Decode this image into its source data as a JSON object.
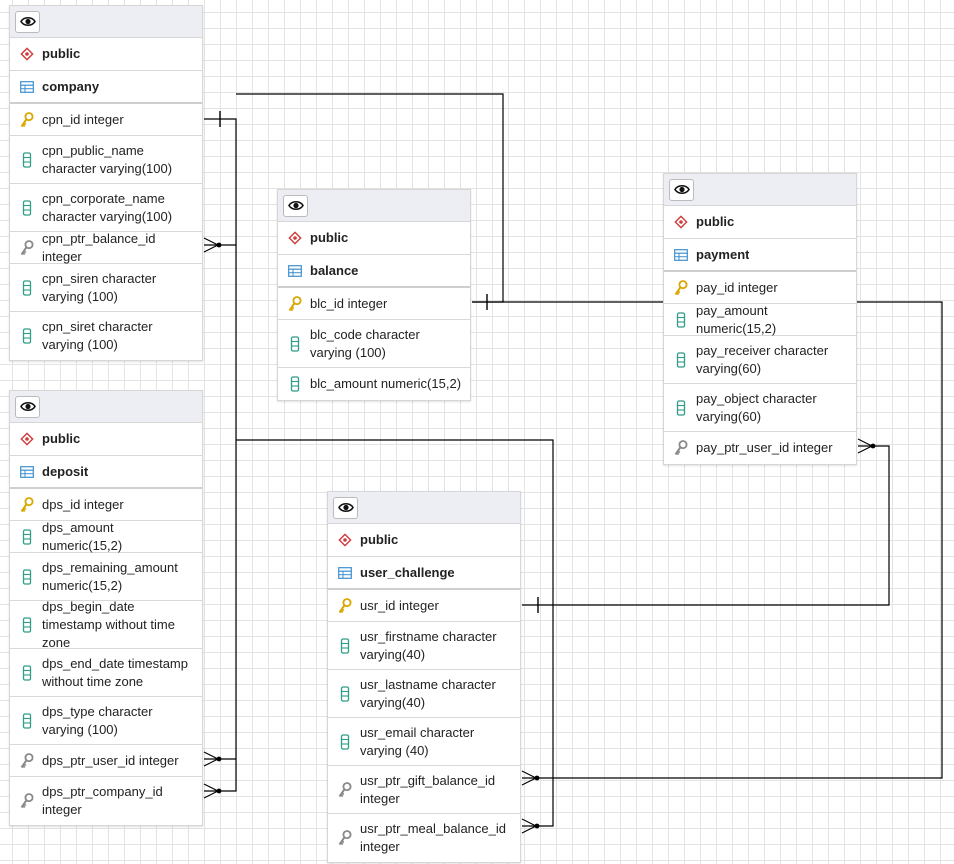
{
  "tables": [
    {
      "id": "company",
      "schema": "public",
      "name": "company",
      "columns": [
        {
          "label": "cpn_id integer",
          "kind": "pk"
        },
        {
          "label": "cpn_public_name character varying(100)",
          "kind": "col"
        },
        {
          "label": "cpn_corporate_name character varying(100)",
          "kind": "col"
        },
        {
          "label": "cpn_ptr_balance_id integer",
          "kind": "fk"
        },
        {
          "label": "cpn_siren character varying (100)",
          "kind": "col"
        },
        {
          "label": "cpn_siret character varying (100)",
          "kind": "col"
        }
      ]
    },
    {
      "id": "balance",
      "schema": "public",
      "name": "balance",
      "columns": [
        {
          "label": "blc_id integer",
          "kind": "pk"
        },
        {
          "label": "blc_code character varying (100)",
          "kind": "col"
        },
        {
          "label": "blc_amount numeric(15,2)",
          "kind": "col"
        }
      ]
    },
    {
      "id": "payment",
      "schema": "public",
      "name": "payment",
      "columns": [
        {
          "label": "pay_id integer",
          "kind": "pk"
        },
        {
          "label": "pay_amount numeric(15,2)",
          "kind": "col"
        },
        {
          "label": "pay_receiver character varying(60)",
          "kind": "col"
        },
        {
          "label": "pay_object character varying(60)",
          "kind": "col"
        },
        {
          "label": "pay_ptr_user_id integer",
          "kind": "fk"
        }
      ]
    },
    {
      "id": "deposit",
      "schema": "public",
      "name": "deposit",
      "columns": [
        {
          "label": "dps_id integer",
          "kind": "pk"
        },
        {
          "label": "dps_amount numeric(15,2)",
          "kind": "col"
        },
        {
          "label": "dps_remaining_amount numeric(15,2)",
          "kind": "col"
        },
        {
          "label": "dps_begin_date timestamp without time zone",
          "kind": "col"
        },
        {
          "label": "dps_end_date timestamp without time zone",
          "kind": "col"
        },
        {
          "label": "dps_type character varying (100)",
          "kind": "col"
        },
        {
          "label": "dps_ptr_user_id integer",
          "kind": "fk"
        },
        {
          "label": "dps_ptr_company_id integer",
          "kind": "fk"
        }
      ]
    },
    {
      "id": "user_challenge",
      "schema": "public",
      "name": "user_challenge",
      "columns": [
        {
          "label": "usr_id integer",
          "kind": "pk"
        },
        {
          "label": "usr_firstname character varying(40)",
          "kind": "col"
        },
        {
          "label": "usr_lastname character varying(40)",
          "kind": "col"
        },
        {
          "label": "usr_email character varying (40)",
          "kind": "col"
        },
        {
          "label": "usr_ptr_gift_balance_id integer",
          "kind": "fk"
        },
        {
          "label": "usr_ptr_meal_balance_id integer",
          "kind": "fk"
        }
      ]
    }
  ],
  "relations": [
    {
      "from": "company.cpn_ptr_balance_id",
      "to": "balance.blc_id"
    },
    {
      "from": "deposit.dps_ptr_company_id",
      "to": "company.cpn_id"
    },
    {
      "from": "deposit.dps_ptr_user_id",
      "to": "user_challenge.usr_id"
    },
    {
      "from": "payment.pay_ptr_user_id",
      "to": "user_challenge.usr_id"
    },
    {
      "from": "user_challenge.usr_ptr_gift_balance_id",
      "to": "balance.blc_id"
    },
    {
      "from": "user_challenge.usr_ptr_meal_balance_id",
      "to": "balance.blc_id"
    }
  ],
  "colors": {
    "pk": "#d9a800",
    "col": "#2e9e86",
    "fk": "#8a8a8a",
    "schema": "#d03a3a",
    "table": "#3d8fd1",
    "line": "#000000"
  }
}
